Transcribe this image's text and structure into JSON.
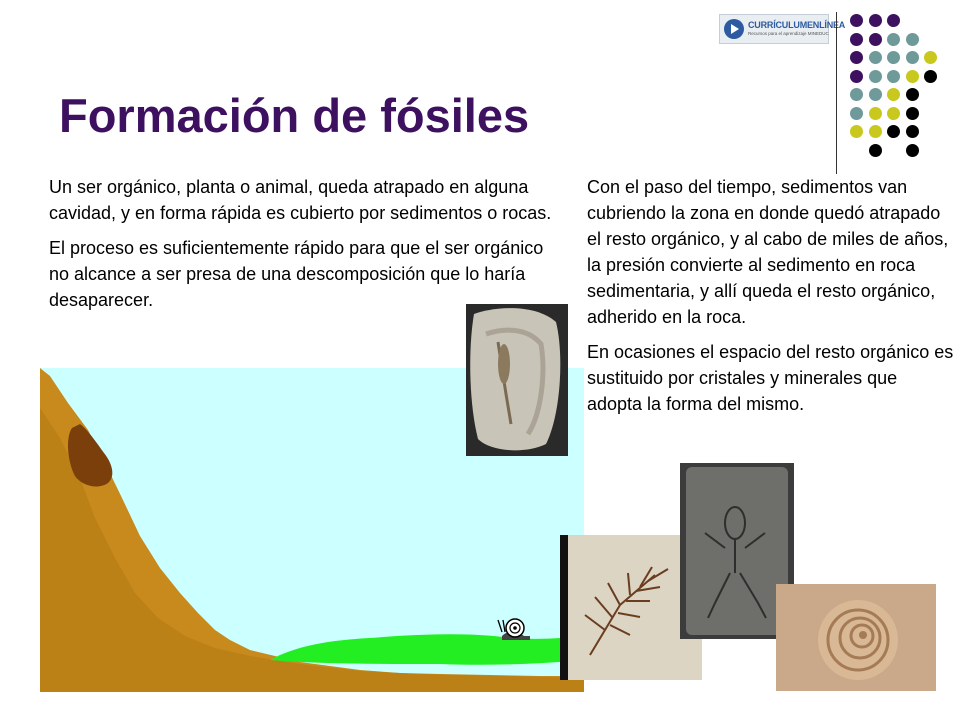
{
  "logo": {
    "name": "CURRÍCULUMENLÍNEA",
    "subtitle": "Recursos para el aprendizaje MINEDUC"
  },
  "title": "Formación de fósiles",
  "left_column": {
    "paragraph_1": "Un ser orgánico, planta o animal, queda atrapado en alguna cavidad, y en forma rápida es cubierto por sedimentos o rocas.",
    "paragraph_2": "El proceso es suficientemente rápido para que el ser orgánico no alcance a ser presa de una descomposición que lo haría desaparecer."
  },
  "right_column": {
    "paragraph_1": "Con el paso del tiempo, sedimentos van cubriendo la zona en donde quedó atrapado el resto orgánico, y al cabo de miles de años, la presión convierte al sedimento en roca sedimentaria, y allí queda el resto orgánico, adherido en la roca.",
    "paragraph_2": "En ocasiones el espacio del resto orgánico es sustituido por cristales y minerales que adopta la forma del mismo."
  },
  "colors": {
    "title": "#3d1060",
    "dot_purple": "#3d1060",
    "dot_teal": "#6f9a9a",
    "dot_yellow": "#c8c81e",
    "dot_black": "#000000",
    "sky": "#ccffff",
    "hill": "#c88a1c",
    "grass": "#22ee22"
  },
  "dot_grid": [
    [
      "purple",
      "purple",
      "purple",
      null,
      null
    ],
    [
      "purple",
      "purple",
      "teal",
      "teal",
      null
    ],
    [
      "purple",
      "teal",
      "teal",
      "teal",
      "yellow"
    ],
    [
      "purple",
      "teal",
      "teal",
      "yellow",
      "black"
    ],
    [
      "teal",
      "teal",
      "yellow",
      "black",
      null
    ],
    [
      "teal",
      "yellow",
      "yellow",
      "black",
      null
    ],
    [
      "yellow",
      "yellow",
      "black",
      "black",
      null
    ],
    [
      null,
      "black",
      null,
      "black",
      null
    ]
  ]
}
